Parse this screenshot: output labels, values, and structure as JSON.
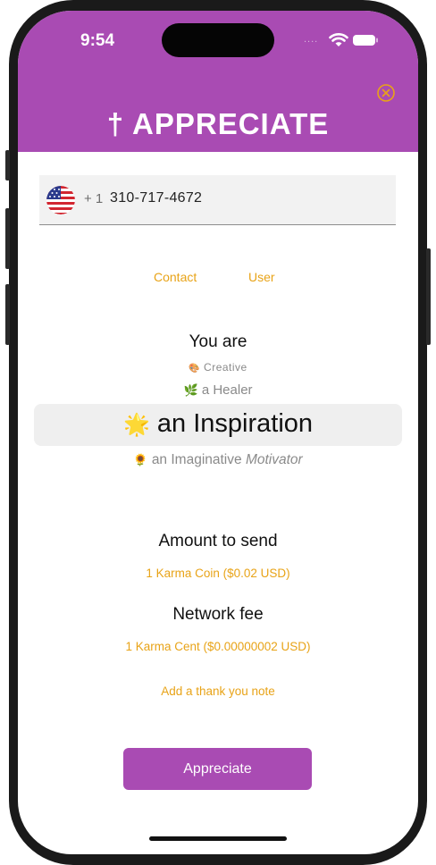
{
  "status_bar": {
    "time": "9:54",
    "signal_dots": "...."
  },
  "header": {
    "title": "† APPRECIATE"
  },
  "phone": {
    "dial_code": "+ 1",
    "number": "310-717-4672"
  },
  "tabs": [
    {
      "label": "Contact"
    },
    {
      "label": "User"
    }
  ],
  "picker": {
    "heading": "You are",
    "items": [
      {
        "emoji": "🎨",
        "text": "Creative"
      },
      {
        "emoji": "🌿",
        "text": "a Healer"
      },
      {
        "emoji": "🌟",
        "text": "an Inspiration"
      },
      {
        "emoji": "🌻",
        "text": "an Imaginative",
        "text2": "Motivator"
      }
    ]
  },
  "amount": {
    "label": "Amount to send",
    "value": "1 Karma Coin ($0.02 USD)"
  },
  "fee": {
    "label": "Network fee",
    "value": "1 Karma Cent ($0.00000002 USD)"
  },
  "note_link": "Add a thank you note",
  "submit_button": "Appreciate",
  "colors": {
    "header": "#a94bb3",
    "accent": "#e8a317",
    "button": "#a94bb3"
  }
}
